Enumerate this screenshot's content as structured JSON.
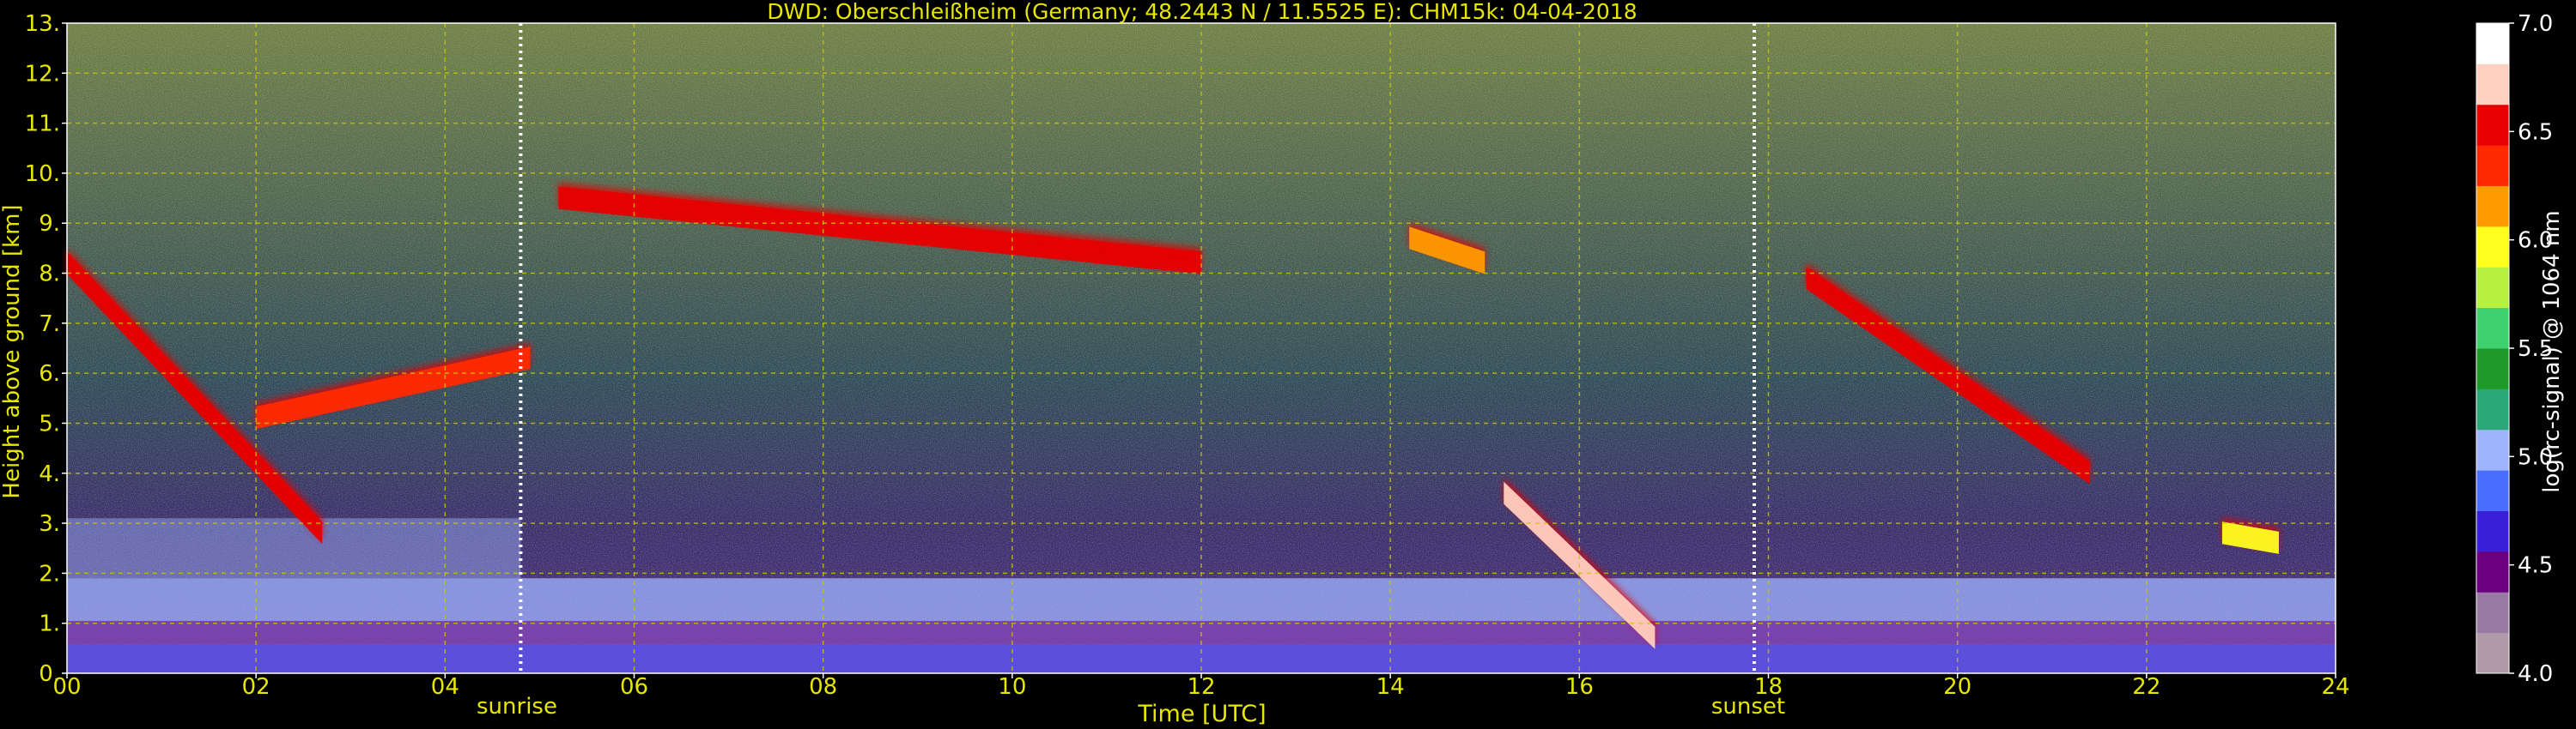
{
  "chart_data": {
    "type": "heatmap",
    "title": "DWD: Oberschleißheim (Germany; 48.2443 N / 11.5525 E):    CHM15k: 04-04-2018",
    "xlabel": "Time [UTC]",
    "ylabel": "Height above ground [km]",
    "xlim": [
      0,
      24
    ],
    "ylim": [
      0,
      13
    ],
    "x_ticks": [
      "00",
      "02",
      "04",
      "06",
      "08",
      "10",
      "12",
      "14",
      "16",
      "18",
      "20",
      "22",
      "24"
    ],
    "y_ticks": [
      "0.",
      "1.",
      "2.",
      "3.",
      "4.",
      "5.",
      "6.",
      "7.",
      "8.",
      "9.",
      "10.",
      "11.",
      "12.",
      "13."
    ],
    "grid": true,
    "annotations": [
      {
        "label": "sunrise",
        "x": 4.8
      },
      {
        "label": "sunset",
        "x": 17.85
      }
    ],
    "colorbar": {
      "label": "log(rc-signal) @ 1064 nm",
      "range": [
        4.0,
        7.0
      ],
      "tick_labels": [
        "4.0",
        "4.5",
        "5.0",
        "5.5",
        "6.0",
        "6.5",
        "7.0"
      ]
    },
    "features": [
      {
        "kind": "aerosol_layer",
        "x": [
          0,
          24
        ],
        "y": [
          0,
          1.9
        ],
        "level": 5.0
      },
      {
        "kind": "residual_layer",
        "x": [
          0,
          4.8
        ],
        "y": [
          1.9,
          3.1
        ],
        "level": 5.0
      },
      {
        "kind": "cloud",
        "x": [
          0,
          2.7
        ],
        "top": [
          8.5,
          3.1
        ],
        "level": 6.6
      },
      {
        "kind": "cloud",
        "x": [
          2.0,
          4.9
        ],
        "top": [
          5.4,
          6.6
        ],
        "level": 6.3
      },
      {
        "kind": "cloud",
        "x": [
          5.2,
          12.0
        ],
        "top": [
          9.8,
          8.5
        ],
        "level": 6.5
      },
      {
        "kind": "cloud",
        "x": [
          14.2,
          15.0
        ],
        "top": [
          9.0,
          8.5
        ],
        "level": 6.2
      },
      {
        "kind": "cloud",
        "x": [
          15.2,
          16.8
        ],
        "top": [
          3.9,
          1.0
        ],
        "level": 6.7
      },
      {
        "kind": "cloud",
        "x": [
          18.4,
          21.4
        ],
        "top": [
          8.2,
          4.3
        ],
        "level": 6.6
      },
      {
        "kind": "cloud",
        "x": [
          22.8,
          23.4
        ],
        "top": [
          3.1,
          2.9
        ],
        "level": 6.0
      }
    ]
  },
  "colors": {
    "text": "#e6e600",
    "grid": "#c8c800",
    "colorbar_stops": [
      "#b09aa8",
      "#9a7aa4",
      "#6a0080",
      "#3a1fd8",
      "#4a6cff",
      "#9fb4ff",
      "#2aa878",
      "#1f9a2a",
      "#3fd070",
      "#b8f040",
      "#ffff20",
      "#ff9a00",
      "#ff2a00",
      "#e60000",
      "#ffd0c0",
      "#ffffff"
    ]
  }
}
